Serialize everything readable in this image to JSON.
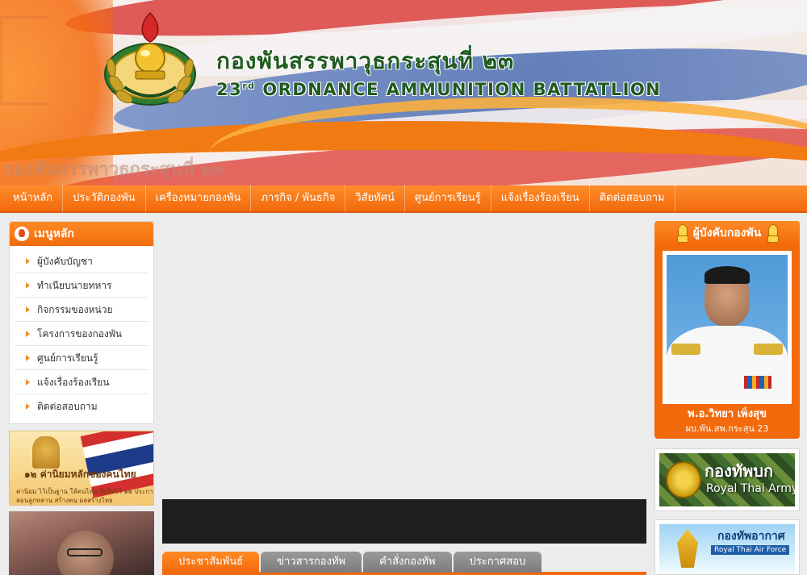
{
  "header": {
    "title_th": "กองพันสรรพาวุธกระสุนที่ ๒๓",
    "title_en_prefix": "23",
    "title_en_sup": "rd",
    "title_en_suffix": " ORDNANCE AMMUNITION BATTATLION",
    "faded_text": "กองพันสรรพาวุธกระสุนที่ ๒๓",
    "logo_icon": "ordnance-emblem-icon"
  },
  "nav": {
    "items": [
      {
        "label": "หน้าหลัก"
      },
      {
        "label": "ประวัติกองพัน"
      },
      {
        "label": "เครื่องหมายกองพัน"
      },
      {
        "label": "ภารกิจ / พันธกิจ"
      },
      {
        "label": "วิสัยทัศน์"
      },
      {
        "label": "ศูนย์การเรียนรู้"
      },
      {
        "label": "แจ้งเรื่องร้องเรียน"
      },
      {
        "label": "ติดต่อสอบถาม"
      }
    ]
  },
  "left_menu": {
    "title": "เมนูหลัก",
    "items": [
      {
        "label": "ผู้บังคับบัญชา"
      },
      {
        "label": "ทำเนียบนายทหาร"
      },
      {
        "label": "กิจกรรมของหน่วย"
      },
      {
        "label": "โครงการของกองพัน"
      },
      {
        "label": "ศูนย์การเรียนรู้"
      },
      {
        "label": "แจ้งเรื่องร้องเรียน"
      },
      {
        "label": "ติดต่อสอบถาม"
      }
    ]
  },
  "values_banner": {
    "title": "๑๒ ค่านิยมหลักของคนไทย",
    "line1": "ค่านิยม ไว้เป็นฐาน ให้คนไทย ยึดถือไว้ ๑๒ ประการ",
    "line2": "สอนลูกหลาน สร้างคน ผลสร้างไทย"
  },
  "tabs": [
    {
      "label": "ประชาสัมพันธ์",
      "active": true
    },
    {
      "label": "ข่าวสารกองทัพ",
      "active": false
    },
    {
      "label": "คำสั่งกองทัพ",
      "active": false
    },
    {
      "label": "ประกาศสอบ",
      "active": false
    }
  ],
  "commander": {
    "title": "ผู้บังคับกองพัน",
    "name": "พ.อ.วิทยา เพ็งสุข",
    "position": "ผบ.พัน.สพ.กระสุน 23"
  },
  "links": {
    "army_th": "กองทัพบก",
    "army_en": "Royal Thai Army",
    "airforce_th": "กองทัพอากาศ",
    "airforce_en": "Royal Thai Air Force"
  },
  "colors": {
    "accent": "#f26a0c",
    "title_green": "#1f5a1f",
    "tab_inactive": "#8a8a8a"
  }
}
